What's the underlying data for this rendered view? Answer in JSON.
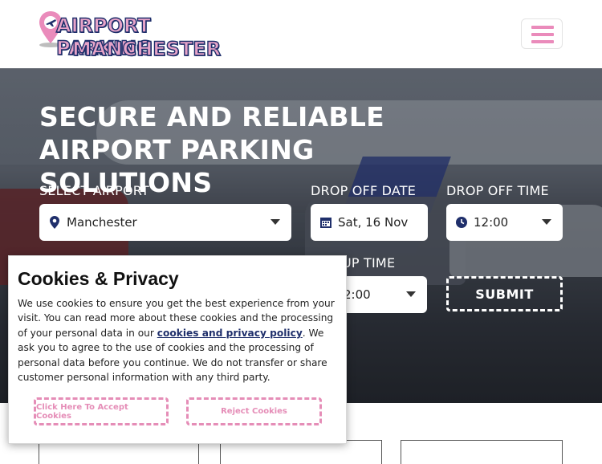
{
  "header": {
    "logo_line1": "AIRPORT PARKING",
    "logo_line2": "MANCHESTER",
    "menu_icon": "hamburger-menu-icon"
  },
  "hero": {
    "title": "SECURE AND RELIABLE AIRPORT PARKING SOLUTIONS"
  },
  "form": {
    "select_airport_label": "SELECT AIRPORT",
    "airport_value": "Manchester",
    "dropoff_date_label": "DROP OFF DATE",
    "dropoff_date_value": "Sat, 16 Nov",
    "dropoff_time_label": "DROP OFF TIME",
    "dropoff_time_value": "12:00",
    "pickup_time_label_partial": "UP TIME",
    "pickup_time_value_partial": "2:00",
    "submit_label": "SUBMIT"
  },
  "cookie_banner": {
    "title": "Cookies & Privacy",
    "text_before_link": "We use cookies to ensure you get the best experience from your visit. You can read more about these cookies and the processing of your personal data in our ",
    "link_text": "cookies and privacy policy",
    "text_after_link": ". We ask you to agree to the use of cookies and the processing of personal data before you continue. We do not transfer or share customer personal information with any third party.",
    "accept_label": "Click Here To Accept Cookies",
    "reject_label": "Reject Cookies"
  },
  "colors": {
    "brand_pink": "#ea8bbb",
    "brand_navy": "#1f2f6b",
    "cookie_button": "#e58db7"
  }
}
